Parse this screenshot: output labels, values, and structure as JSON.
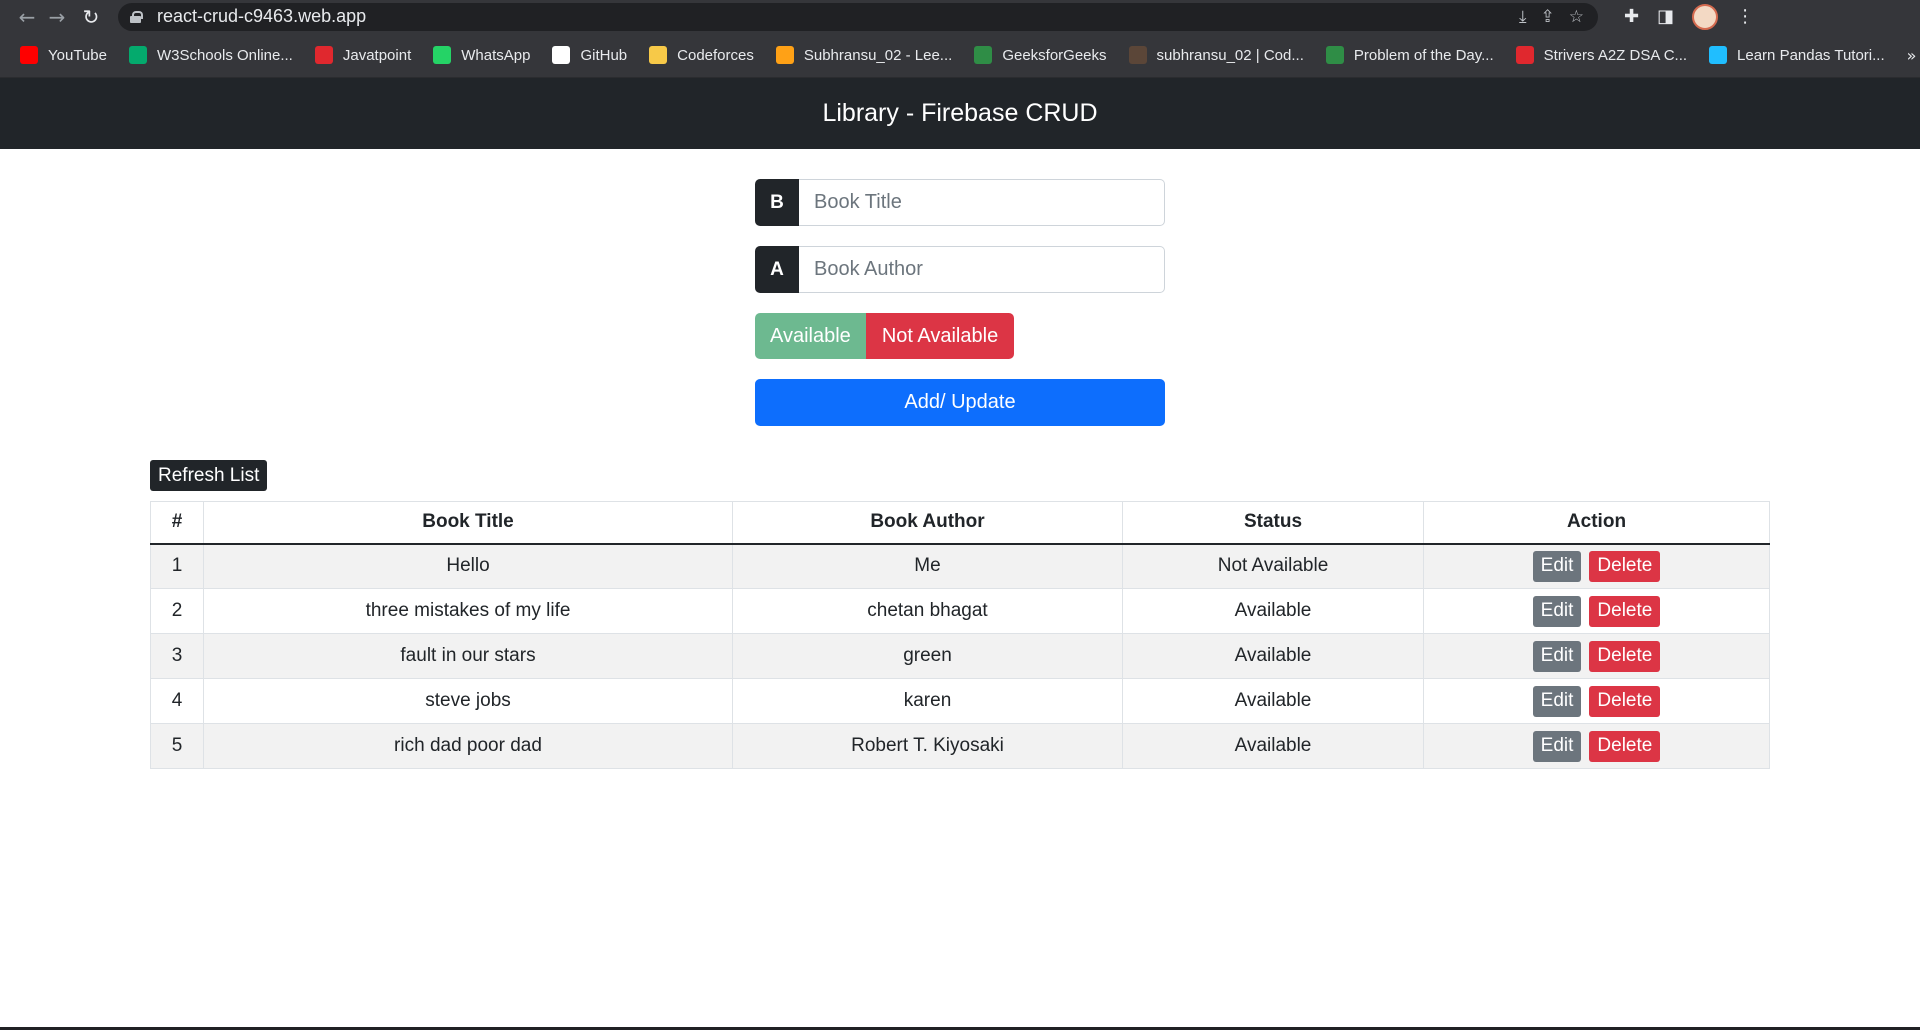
{
  "browser": {
    "url": "react-crud-c9463.web.app",
    "bookmarks": [
      {
        "label": "YouTube",
        "icon": "youtube-icon",
        "color": "#ff0000"
      },
      {
        "label": "W3Schools Online...",
        "icon": "w3schools-icon",
        "color": "#04aa6d"
      },
      {
        "label": "Javatpoint",
        "icon": "javatpoint-icon",
        "color": "#e0282e"
      },
      {
        "label": "WhatsApp",
        "icon": "whatsapp-icon",
        "color": "#25d366"
      },
      {
        "label": "GitHub",
        "icon": "github-icon",
        "color": "#ffffff"
      },
      {
        "label": "Codeforces",
        "icon": "codeforces-icon",
        "color": "#f7c948"
      },
      {
        "label": "Subhransu_02 - Lee...",
        "icon": "leetcode-icon",
        "color": "#ffa116"
      },
      {
        "label": "GeeksforGeeks",
        "icon": "geeksforgeeks-icon",
        "color": "#2f8d46"
      },
      {
        "label": "subhransu_02 | Cod...",
        "icon": "codechef-icon",
        "color": "#5b4638"
      },
      {
        "label": "Problem of the Day...",
        "icon": "geeksforgeeks-icon",
        "color": "#2f8d46"
      },
      {
        "label": "Strivers A2Z DSA C...",
        "icon": "takeuforward-icon",
        "color": "#e0282e"
      },
      {
        "label": "Learn Pandas Tutori...",
        "icon": "kaggle-icon",
        "color": "#20beff"
      }
    ],
    "more_glyph": "»"
  },
  "navbar": {
    "title": "Library - Firebase CRUD"
  },
  "form": {
    "title_prefix": "B",
    "title_placeholder": "Book Title",
    "author_prefix": "A",
    "author_placeholder": "Book Author",
    "available_label": "Available",
    "not_available_label": "Not Available",
    "submit_label": "Add/ Update"
  },
  "refresh_label": "Refresh List",
  "table": {
    "headers": [
      "#",
      "Book Title",
      "Book Author",
      "Status",
      "Action"
    ],
    "rows": [
      {
        "num": "1",
        "title": "Hello",
        "author": "Me",
        "status": "Not Available"
      },
      {
        "num": "2",
        "title": "three mistakes of my life",
        "author": "chetan bhagat",
        "status": "Available"
      },
      {
        "num": "3",
        "title": "fault in our stars",
        "author": "green",
        "status": "Available"
      },
      {
        "num": "4",
        "title": "steve jobs",
        "author": "karen",
        "status": "Available"
      },
      {
        "num": "5",
        "title": "rich dad poor dad",
        "author": "Robert T. Kiyosaki",
        "status": "Available"
      }
    ],
    "edit_label": "Edit",
    "delete_label": "Delete"
  },
  "colors": {
    "navbar": "#212529",
    "primary": "#0d6efd",
    "success": "#6db990",
    "danger": "#dc3545",
    "secondary": "#6c757d"
  }
}
